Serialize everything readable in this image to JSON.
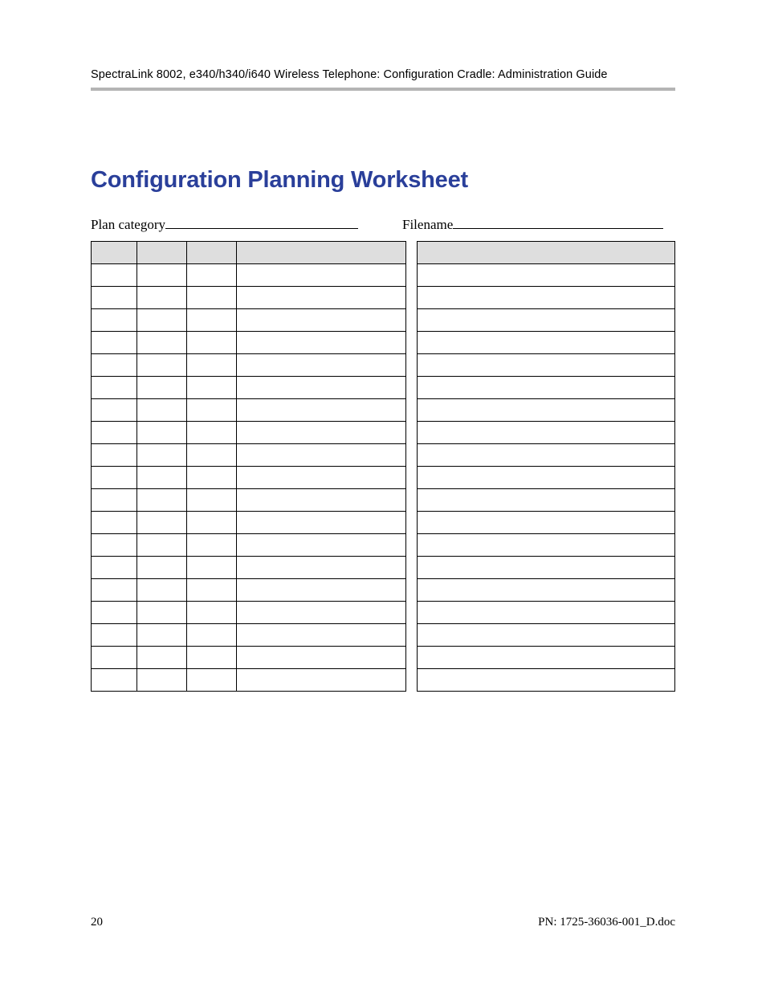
{
  "header": {
    "running": "SpectraLink 8002, e340/h340/i640 Wireless Telephone: Configuration Cradle: Administration Guide"
  },
  "section": {
    "title": "Configuration Planning Worksheet"
  },
  "fields": {
    "plan_label": "Plan category",
    "filename_label": "Filename"
  },
  "table": {
    "row_count": 19
  },
  "footer": {
    "page_number": "20",
    "pn": "PN: 1725-36036-001_D.doc"
  }
}
